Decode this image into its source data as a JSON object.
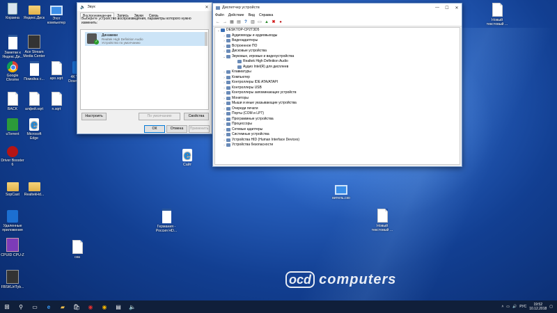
{
  "desktop_icons": [
    {
      "label": "Корзина",
      "icon": "recycle-bin-icon",
      "type": "bin"
    },
    {
      "label": "Яндекс.Диск",
      "icon": "folder-icon",
      "type": "folder"
    },
    {
      "label": "Этот компьютер",
      "icon": "this-pc-icon",
      "type": "pc"
    },
    {
      "label": "Заметки к Яндекс.Ди...",
      "icon": "document-icon",
      "type": "doc"
    },
    {
      "label": "Ace Stream Media Center",
      "icon": "ace-stream-icon",
      "type": "dark"
    },
    {
      "label": "Google Chrome",
      "icon": "chrome-icon",
      "type": "chrome"
    },
    {
      "label": "Помойка с...",
      "icon": "document-icon",
      "type": "doc"
    },
    {
      "label": "apo.sqrt",
      "icon": "document-icon",
      "type": "file"
    },
    {
      "label": "4K Video Downloader",
      "icon": "app-icon",
      "type": "blue"
    },
    {
      "label": "BACK",
      "icon": "document-icon",
      "type": "file"
    },
    {
      "label": "алфей.sqrt",
      "icon": "document-icon",
      "type": "file"
    },
    {
      "label": "n.sqrt",
      "icon": "document-icon",
      "type": "file"
    },
    {
      "label": "uTorrent",
      "icon": "utorrent-icon",
      "type": "green"
    },
    {
      "label": "Microsoft Edge",
      "icon": "edge-icon",
      "type": "edge"
    },
    {
      "label": "Driver Booster 6",
      "icon": "driver-booster-icon",
      "type": "red"
    },
    {
      "label": "SopCast",
      "icon": "folder-icon",
      "type": "folder"
    },
    {
      "label": "RealtekHd...",
      "icon": "folder-icon",
      "type": "folder"
    },
    {
      "label": "Удаленные приложения",
      "icon": "remote-apps-icon",
      "type": "blue"
    },
    {
      "label": "CPUID CPU-Z",
      "icon": "cpuz-icon",
      "type": "cpu"
    },
    {
      "label": "FBSKUrlTyb...",
      "icon": "document-icon",
      "type": "dark"
    },
    {
      "label": "Сайт",
      "icon": "edge-icon",
      "type": "edge"
    },
    {
      "label": "Германия - Россия HD...",
      "icon": "document-icon",
      "type": "doc"
    },
    {
      "label": "ска",
      "icon": "document-icon",
      "type": "file"
    },
    {
      "label": "Новый текстовый ...",
      "icon": "document-icon",
      "type": "file"
    },
    {
      "label": "Новый текстовый ...",
      "icon": "document-icon",
      "type": "file"
    },
    {
      "label": "витель.ско",
      "icon": "image-icon",
      "type": "pc"
    }
  ],
  "sound_dialog": {
    "title": "Звук",
    "tabs": [
      "Воспроизведение",
      "Запись",
      "Звуки",
      "Связь"
    ],
    "instruction": "Выберите устройство воспроизведения, параметры которого нужно изменить:",
    "device_name": "Динамики",
    "device_driver": "Realtek High Definition Audio",
    "device_status": "Устройство по умолчанию",
    "configure_btn": "Настроить",
    "default_btn": "По умолчанию",
    "properties_btn": "Свойства",
    "ok_btn": "ОК",
    "cancel_btn": "Отмена",
    "apply_btn": "Применить"
  },
  "device_manager": {
    "title": "Диспетчер устройств",
    "menu": [
      "Файл",
      "Действие",
      "Вид",
      "Справка"
    ],
    "root": "DESKTOP-CP2T3D5",
    "nodes": [
      {
        "label": "Аудиовходы и аудиовыходы",
        "level": 1,
        "expanded": false
      },
      {
        "label": "Видеоадаптеры",
        "level": 1,
        "expanded": false
      },
      {
        "label": "Встроенное ПО",
        "level": 1,
        "expanded": false
      },
      {
        "label": "Дисковые устройства",
        "level": 1,
        "expanded": false
      },
      {
        "label": "Звуковые, игровые и видеоустройства",
        "level": 1,
        "expanded": true
      },
      {
        "label": "Realtek High Definition Audio",
        "level": 2,
        "expanded": false
      },
      {
        "label": "Аудио Intel(R) для дисплеев",
        "level": 2,
        "expanded": false
      },
      {
        "label": "Клавиатуры",
        "level": 1,
        "expanded": false
      },
      {
        "label": "Компьютер",
        "level": 1,
        "expanded": false
      },
      {
        "label": "Контроллеры IDE ATA/ATAPI",
        "level": 1,
        "expanded": false
      },
      {
        "label": "Контроллеры USB",
        "level": 1,
        "expanded": false
      },
      {
        "label": "Контроллеры запоминающих устройств",
        "level": 1,
        "expanded": false
      },
      {
        "label": "Мониторы",
        "level": 1,
        "expanded": false
      },
      {
        "label": "Мыши и иные указывающие устройства",
        "level": 1,
        "expanded": false
      },
      {
        "label": "Очереди печати",
        "level": 1,
        "expanded": false
      },
      {
        "label": "Порты (COM и LPT)",
        "level": 1,
        "expanded": false
      },
      {
        "label": "Программные устройства",
        "level": 1,
        "expanded": false
      },
      {
        "label": "Процессоры",
        "level": 1,
        "expanded": false
      },
      {
        "label": "Сетевые адаптеры",
        "level": 1,
        "expanded": false
      },
      {
        "label": "Системные устройства",
        "level": 1,
        "expanded": false
      },
      {
        "label": "Устройства HID (Human Interface Devices)",
        "level": 1,
        "expanded": false
      },
      {
        "label": "Устройства безопасности",
        "level": 1,
        "expanded": false
      }
    ]
  },
  "taskbar": {
    "lang": "РУС",
    "time": "19:52",
    "date": "10.12.2018"
  },
  "watermark": {
    "logo": "ocd",
    "text": "computers"
  }
}
